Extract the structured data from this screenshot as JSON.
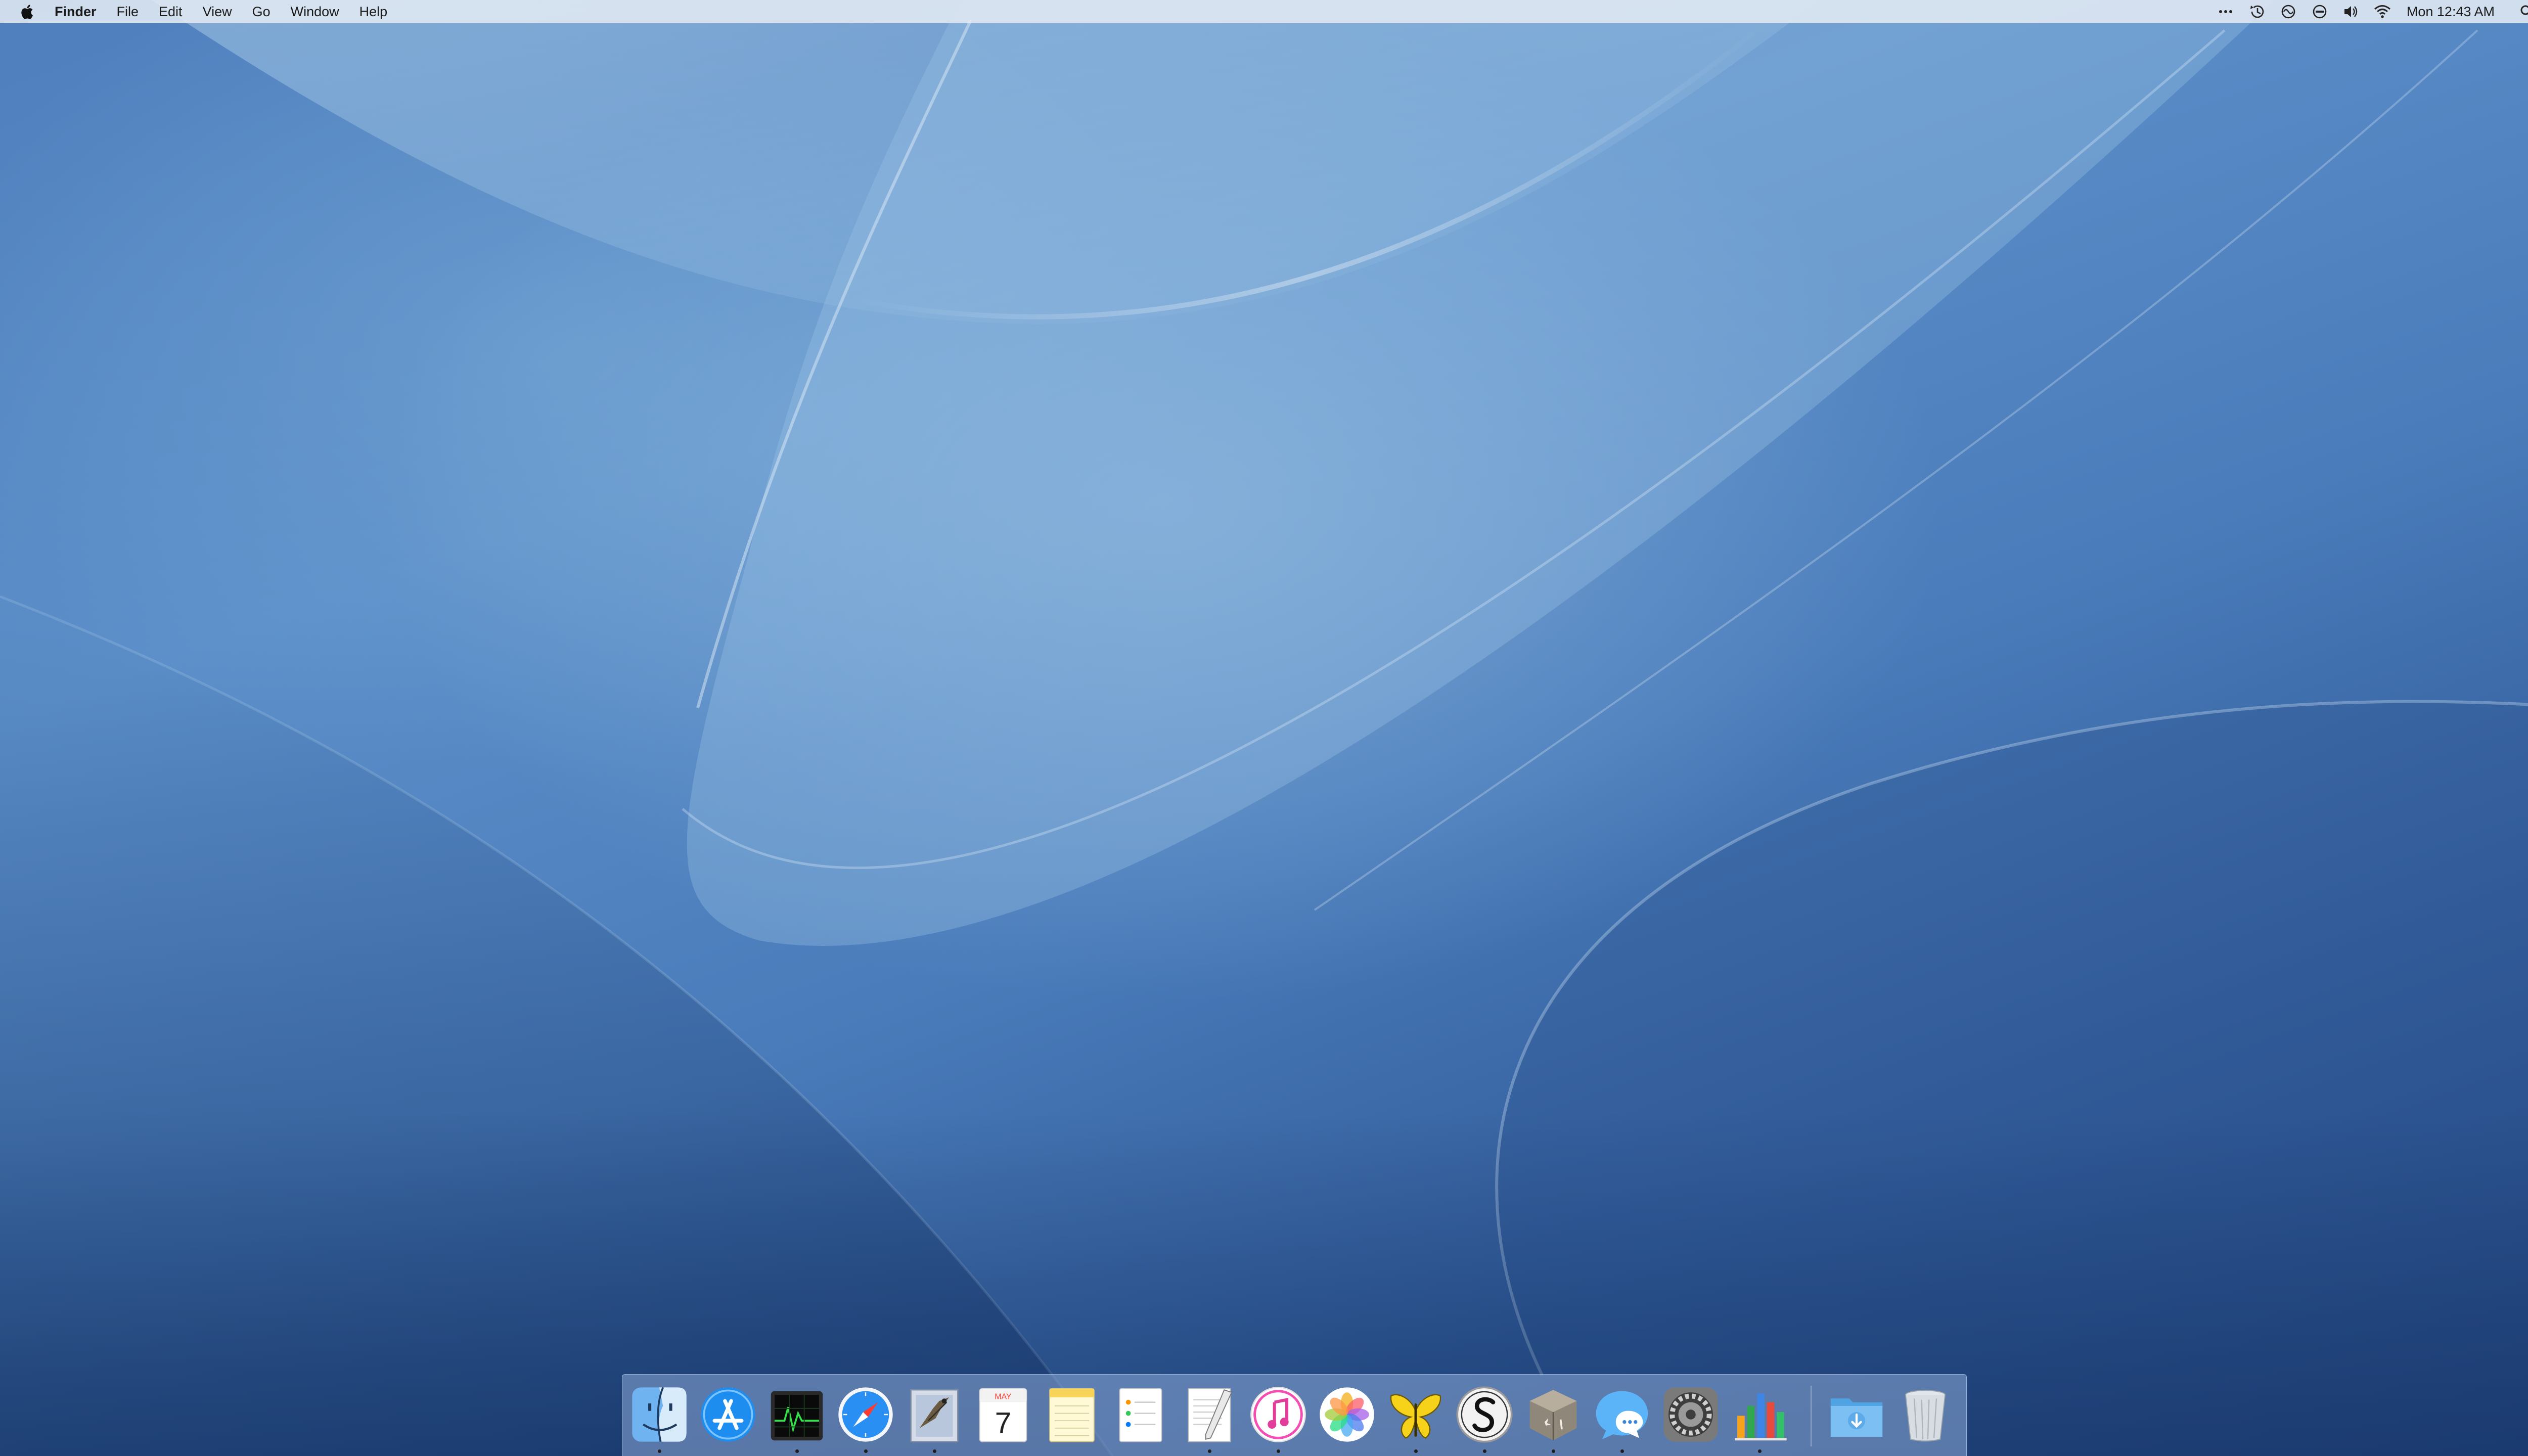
{
  "menubar": {
    "app_name": "Finder",
    "menus": [
      "File",
      "Edit",
      "View",
      "Go",
      "Window",
      "Help"
    ],
    "status_icons": [
      "more-dots-icon",
      "time-machine-icon",
      "siri-icon",
      "do-not-disturb-icon",
      "volume-icon",
      "wifi-icon"
    ],
    "clock": "Mon 12:43 AM",
    "right_icons": [
      "spotlight-icon",
      "notification-center-icon"
    ]
  },
  "dock": {
    "apps": [
      {
        "name": "finder",
        "running": true
      },
      {
        "name": "app-store",
        "running": false
      },
      {
        "name": "activity-monitor",
        "running": true
      },
      {
        "name": "safari",
        "running": true
      },
      {
        "name": "mail",
        "running": true
      },
      {
        "name": "calendar",
        "running": false
      },
      {
        "name": "notes",
        "running": false
      },
      {
        "name": "reminders",
        "running": false
      },
      {
        "name": "textedit",
        "running": true
      },
      {
        "name": "itunes",
        "running": true
      },
      {
        "name": "photos",
        "running": false
      },
      {
        "name": "tes",
        "running": true
      },
      {
        "name": "scrivener",
        "running": true
      },
      {
        "name": "archive-utility",
        "running": true
      },
      {
        "name": "messages",
        "running": true
      },
      {
        "name": "system-preferences",
        "running": false
      },
      {
        "name": "numbers",
        "running": true
      }
    ],
    "calendar": {
      "month": "MAY",
      "day": "7"
    },
    "utilities": [
      "downloads-folder",
      "trash"
    ]
  },
  "colors": {
    "wallpaper_light": "#7fb0dc",
    "wallpaper_dark": "#1f3f77",
    "menubar": "#e1e9f3",
    "dock": "#8caad7"
  }
}
